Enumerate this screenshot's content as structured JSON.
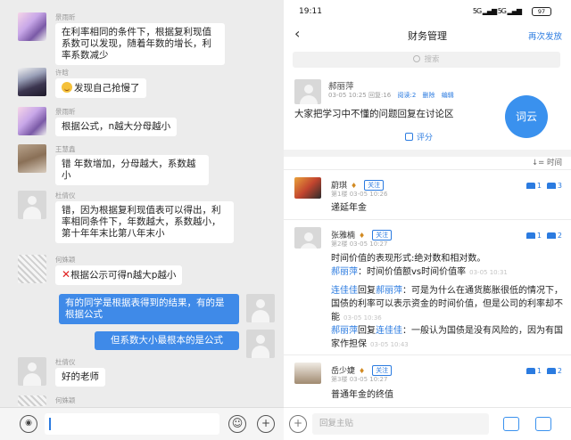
{
  "chat": {
    "messages": [
      {
        "sender": "景雨昕",
        "text": "在利率相同的条件下，根据复利现值系数可以发现，随着年数的增长，利率系数减少"
      },
      {
        "sender": "许晗",
        "text": "发现自己抢慢了"
      },
      {
        "sender": "景雨昕",
        "text": "根据公式，n越大分母越小"
      },
      {
        "sender": "王慧鑫",
        "text": "错 年数增加，分母越大，系数越小"
      },
      {
        "sender": "杜倩仪",
        "text": "错，因为根据复利现值表可以得出，利率相同条件下，年数越大，系数越小，第十年年末比第八年末小"
      },
      {
        "sender": "何姝颖",
        "text": "根据公示可得n越大p越小"
      },
      {
        "sender": "",
        "text": "有的同学是根据表得到的结果，有的是根据公式"
      },
      {
        "sender": "",
        "text": "但系数大小最根本的是公式"
      },
      {
        "sender": "杜倩仪",
        "text": "好的老师"
      },
      {
        "sender": "何姝颖",
        "text": ""
      }
    ]
  },
  "phone": {
    "status": {
      "time": "19:11",
      "network": "5G ▂▄▆ 5G ▂▄▆",
      "battery": "97"
    },
    "nav": {
      "title": "财务管理",
      "action": "再次发放"
    },
    "search_placeholder": "搜索",
    "post": {
      "author": "郝丽萍",
      "date": "03-05 10:25",
      "reply_count": "回复:16",
      "read_count": "阅读:2",
      "delete": "删除",
      "edit": "编辑",
      "text": "大家把学习中不懂的问题回复在讨论区",
      "fab": "词云",
      "rate": "评分"
    },
    "sort": "↓= 时间",
    "follow": "关注",
    "replies": [
      {
        "name": "蔚琪",
        "floor": "第1楼",
        "time": "03-05 10:26",
        "score": "1",
        "likes": "3",
        "body": "递延年金"
      },
      {
        "name": "张雅楠",
        "floor": "第2楼",
        "time": "03-05 10:27",
        "score": "1",
        "likes": "2",
        "body": "时间价值的表现形式:绝对数和相对数。"
      },
      {
        "name": "岳少婕",
        "floor": "第3楼",
        "time": "03-05 10:27",
        "score": "1",
        "likes": "2",
        "body": "普通年金的终值"
      }
    ],
    "subs": [
      {
        "name": "郝丽萍",
        "mid": "",
        "to": "",
        "text": "：时间价值额vs时间价值率",
        "time": "03-05 10:31"
      },
      {
        "name": "连佳佳",
        "mid": "回复",
        "to": "郝丽萍",
        "text": "：可是为什么在通货膨胀很低的情况下，国债的利率可以表示资金的时间价值，但是公司的利率却不能",
        "time": "03-05 10:36"
      },
      {
        "name": "郝丽萍",
        "mid": "回复",
        "to": "连佳佳",
        "text": "：一般认为国债是没有风险的，因为有国家作担保",
        "time": "03-05 10:43"
      }
    ],
    "reply_placeholder": "回复主贴"
  }
}
